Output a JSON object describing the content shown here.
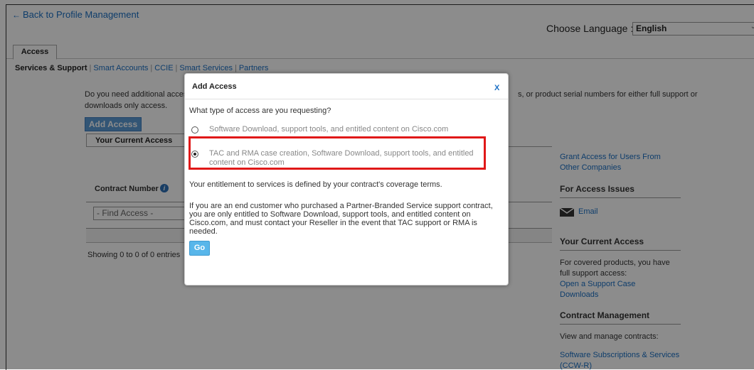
{
  "header": {
    "back_link": "Back to Profile Management",
    "language_label": "Choose Language :",
    "language_value": "English"
  },
  "tabs": {
    "active": "Access"
  },
  "subnav": {
    "current": "Services & Support",
    "links": [
      "Smart Accounts",
      "CCIE",
      "Smart Services",
      "Partners"
    ]
  },
  "intro": {
    "line1": "Do you need additional access",
    "line1_right": "s, or product serial numbers for either full support or",
    "line2": "downloads only access."
  },
  "main": {
    "add_access_button": "Add Access",
    "current_access_tab": "Your Current Access",
    "contract_number_header": "Contract Number",
    "find_placeholder": "- Find Access -",
    "showing": "Showing 0 to 0 of 0 entries"
  },
  "right_panel": {
    "grant_link": "Grant Access for Users From Other Companies",
    "access_issues_heading": "For Access Issues",
    "email_link": "Email",
    "current_access_heading": "Your Current Access",
    "current_access_text": "For covered products, you have full support access:",
    "open_case_link": "Open a Support Case",
    "downloads_link": "Downloads",
    "contract_mgmt_heading": "Contract Management",
    "contract_mgmt_text": "View and manage contracts:",
    "subscriptions_link": "Software Subscriptions & Services (CCW-R)"
  },
  "modal": {
    "title": "Add Access",
    "close": "X",
    "question": "What type of access are you requesting?",
    "options": [
      {
        "label": "Software Download, support tools, and entitled content on Cisco.com",
        "selected": false
      },
      {
        "label": "TAC and RMA case creation, Software Download, support tools, and entitled content on Cisco.com",
        "selected": true
      }
    ],
    "entitlement": "Your entitlement to services is defined by your contract's coverage terms.",
    "note": "If you are an end customer who purchased a Partner-Branded Service support contract, you are only entitled to Software Download, support tools, and entitled content on Cisco.com, and must contact your Reseller in the event that TAC support or RMA is needed.",
    "go_button": "Go"
  },
  "colors": {
    "link": "#1a6fc4",
    "highlight_border": "#e01818",
    "go_button": "#58b6ea",
    "add_access_button": "#5b9bd5"
  },
  "icons": [
    "arrow-left-icon",
    "info-icon",
    "envelope-icon",
    "radio-icon"
  ]
}
